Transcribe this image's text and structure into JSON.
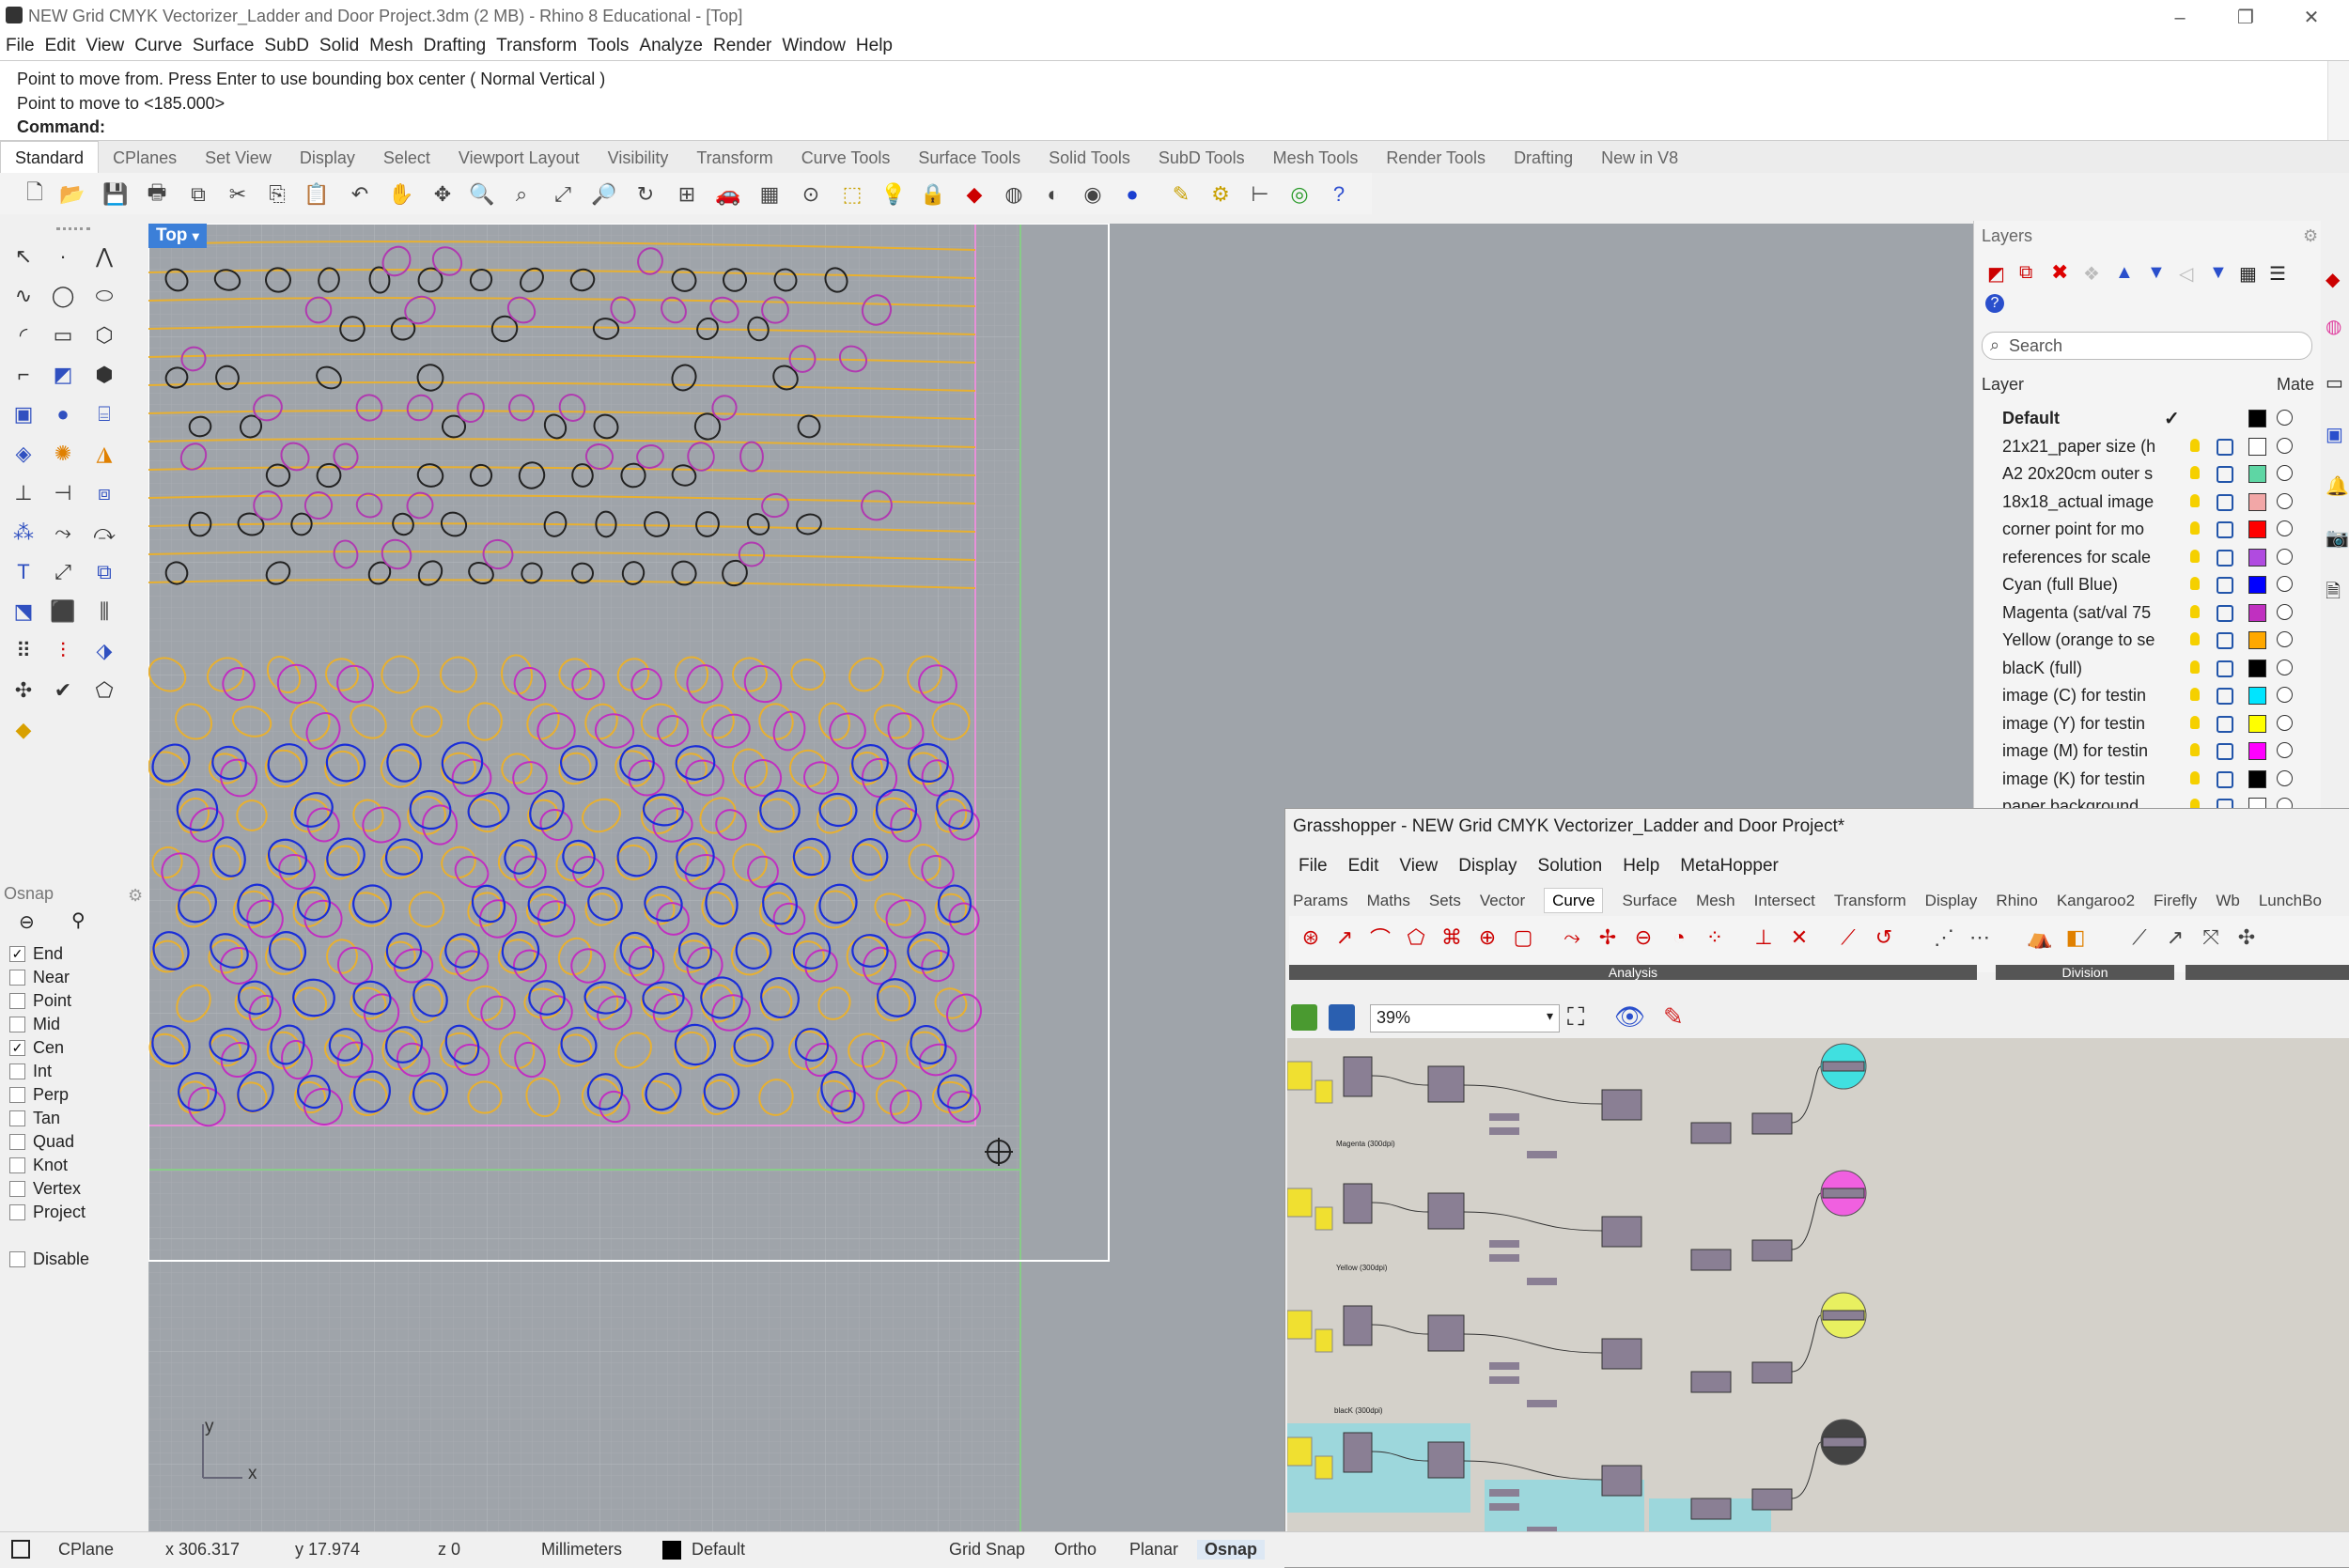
{
  "app": {
    "title": "NEW Grid CMYK Vectorizer_Ladder and Door Project.3dm (2 MB) - Rhino 8 Educational - [Top]"
  },
  "menu": [
    "File",
    "Edit",
    "View",
    "Curve",
    "Surface",
    "SubD",
    "Solid",
    "Mesh",
    "Drafting",
    "Transform",
    "Tools",
    "Analyze",
    "Render",
    "Window",
    "Help"
  ],
  "command": {
    "line1": "Point to move from. Press Enter to use bounding box center ( Normal  Vertical )",
    "line2": "Point to move to <185.000>",
    "prompt": "Command:"
  },
  "toolbar_tabs": [
    "Standard",
    "CPlanes",
    "Set View",
    "Display",
    "Select",
    "Viewport Layout",
    "Visibility",
    "Transform",
    "Curve Tools",
    "Surface Tools",
    "Solid Tools",
    "SubD Tools",
    "Mesh Tools",
    "Render Tools",
    "Drafting",
    "New in V8"
  ],
  "viewport": {
    "label": "Top",
    "axis_x": "x",
    "axis_y": "y"
  },
  "osnap": {
    "title": "Osnap",
    "items": [
      {
        "label": "End",
        "checked": "✓"
      },
      {
        "label": "Near",
        "checked": ""
      },
      {
        "label": "Point",
        "checked": ""
      },
      {
        "label": "Mid",
        "checked": ""
      },
      {
        "label": "Cen",
        "checked": "✓"
      },
      {
        "label": "Int",
        "checked": ""
      },
      {
        "label": "Perp",
        "checked": ""
      },
      {
        "label": "Tan",
        "checked": ""
      },
      {
        "label": "Quad",
        "checked": ""
      },
      {
        "label": "Knot",
        "checked": ""
      },
      {
        "label": "Vertex",
        "checked": ""
      },
      {
        "label": "Project",
        "checked": ""
      }
    ],
    "disable": "Disable"
  },
  "layers": {
    "title": "Layers",
    "search_placeholder": "Search",
    "col_layer": "Layer",
    "col_material": "Mate",
    "rows": [
      {
        "name": "Default",
        "color": "#000000",
        "current": "✓"
      },
      {
        "name": "21x21_paper size (h",
        "color": "#ffffff"
      },
      {
        "name": "A2 20x20cm outer s",
        "color": "#5ed6a4"
      },
      {
        "name": "18x18_actual image",
        "color": "#f2a7a7"
      },
      {
        "name": "corner point for mo",
        "color": "#ff0000"
      },
      {
        "name": "references for scale",
        "color": "#b04be0"
      },
      {
        "name": "Cyan (full Blue)",
        "color": "#0000ff"
      },
      {
        "name": "Magenta (sat/val 75",
        "color": "#c030c0"
      },
      {
        "name": "Yellow (orange to se",
        "color": "#ffa800"
      },
      {
        "name": "blacK (full)",
        "color": "#000000"
      },
      {
        "name": "image (C) for testin",
        "color": "#00e5ff"
      },
      {
        "name": "image (Y) for testin",
        "color": "#ffff00"
      },
      {
        "name": "image (M) for testin",
        "color": "#ff00ff"
      },
      {
        "name": "image (K) for testin",
        "color": "#000000"
      },
      {
        "name": "paper background",
        "color": "#ffffff"
      }
    ]
  },
  "status": {
    "cplane": "CPlane",
    "x": "x 306.317",
    "y": "y 17.974",
    "z": "z 0",
    "units": "Millimeters",
    "layer": "Default",
    "gridsnap": "Grid Snap",
    "ortho": "Ortho",
    "planar": "Planar",
    "osnap": "Osnap"
  },
  "grasshopper": {
    "title": "Grasshopper - NEW Grid CMYK Vectorizer_Ladder and Door Project*",
    "menu": [
      "File",
      "Edit",
      "View",
      "Display",
      "Solution",
      "Help",
      "MetaHopper"
    ],
    "tabs": [
      "Params",
      "Maths",
      "Sets",
      "Vector",
      "Curve",
      "Surface",
      "Mesh",
      "Intersect",
      "Transform",
      "Display",
      "Rhino",
      "Kangaroo2",
      "Firefly",
      "Wb",
      "LunchBo"
    ],
    "active_tab": "Curve",
    "group_analysis": "Analysis",
    "group_division": "Division",
    "zoom": "39%",
    "group_labels": [
      "Magenta (300dpi)",
      "Yellow (300dpi)",
      "blacK (300dpi)"
    ]
  }
}
